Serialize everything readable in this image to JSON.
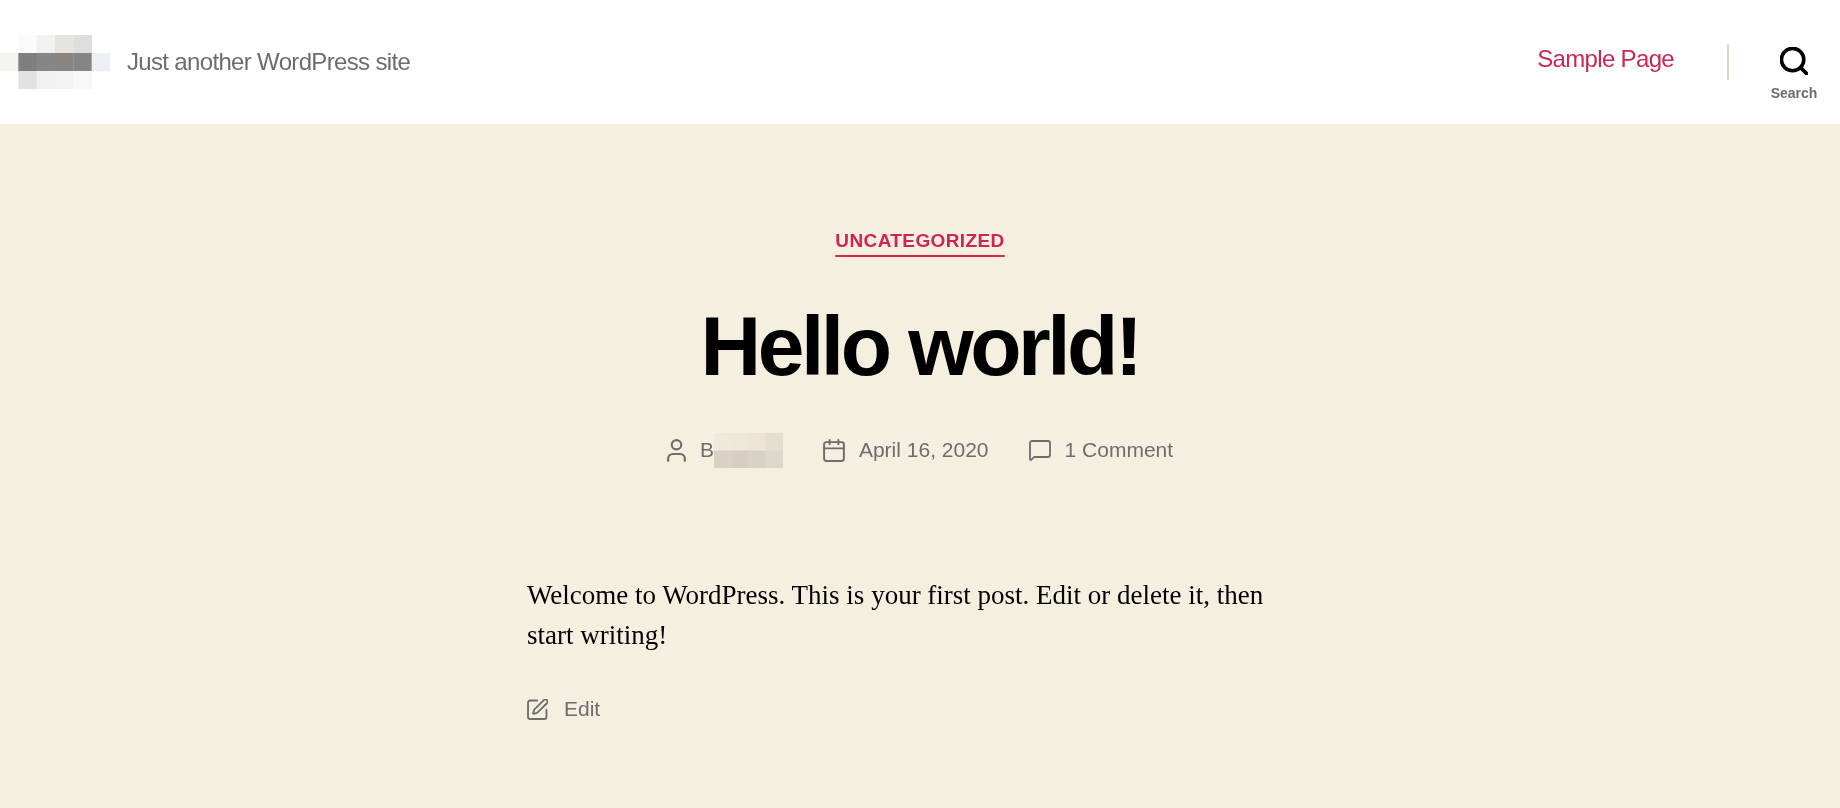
{
  "header": {
    "tagline": "Just another WordPress site",
    "nav": [
      {
        "label": "Sample Page"
      }
    ],
    "search_button": {
      "label": "Search"
    }
  },
  "post": {
    "category": "UNCATEGORIZED",
    "title": "Hello world!",
    "meta": [
      {
        "kind": "author",
        "text": "B"
      },
      {
        "kind": "date",
        "text": "April 16, 2020"
      },
      {
        "kind": "comments",
        "text": "1 Comment"
      }
    ],
    "content": "Welcome to WordPress. This is your first post. Edit or delete it, then start writing!",
    "edit_link": "Edit"
  }
}
